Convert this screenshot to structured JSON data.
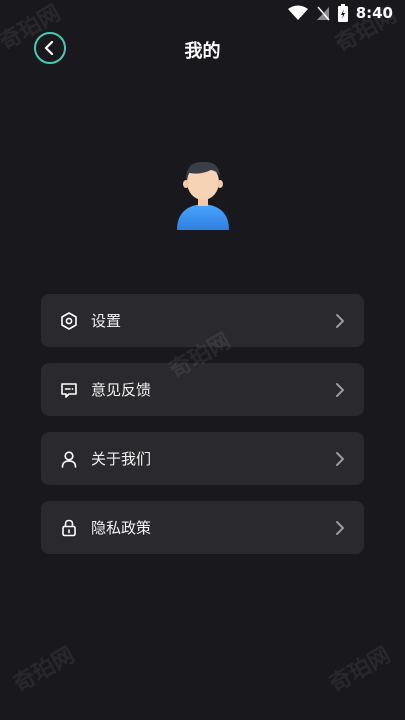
{
  "status_bar": {
    "time": "8:40"
  },
  "header": {
    "title": "我的"
  },
  "menu": {
    "items": [
      {
        "label": "设置",
        "icon": "settings-hexagon-icon"
      },
      {
        "label": "意见反馈",
        "icon": "feedback-icon"
      },
      {
        "label": "关于我们",
        "icon": "user-icon"
      },
      {
        "label": "隐私政策",
        "icon": "lock-icon"
      }
    ]
  },
  "watermark": {
    "text": "奇珀网"
  },
  "colors": {
    "accent": "#49c8b5",
    "background": "#18181d",
    "card": "#2a2a2e"
  }
}
